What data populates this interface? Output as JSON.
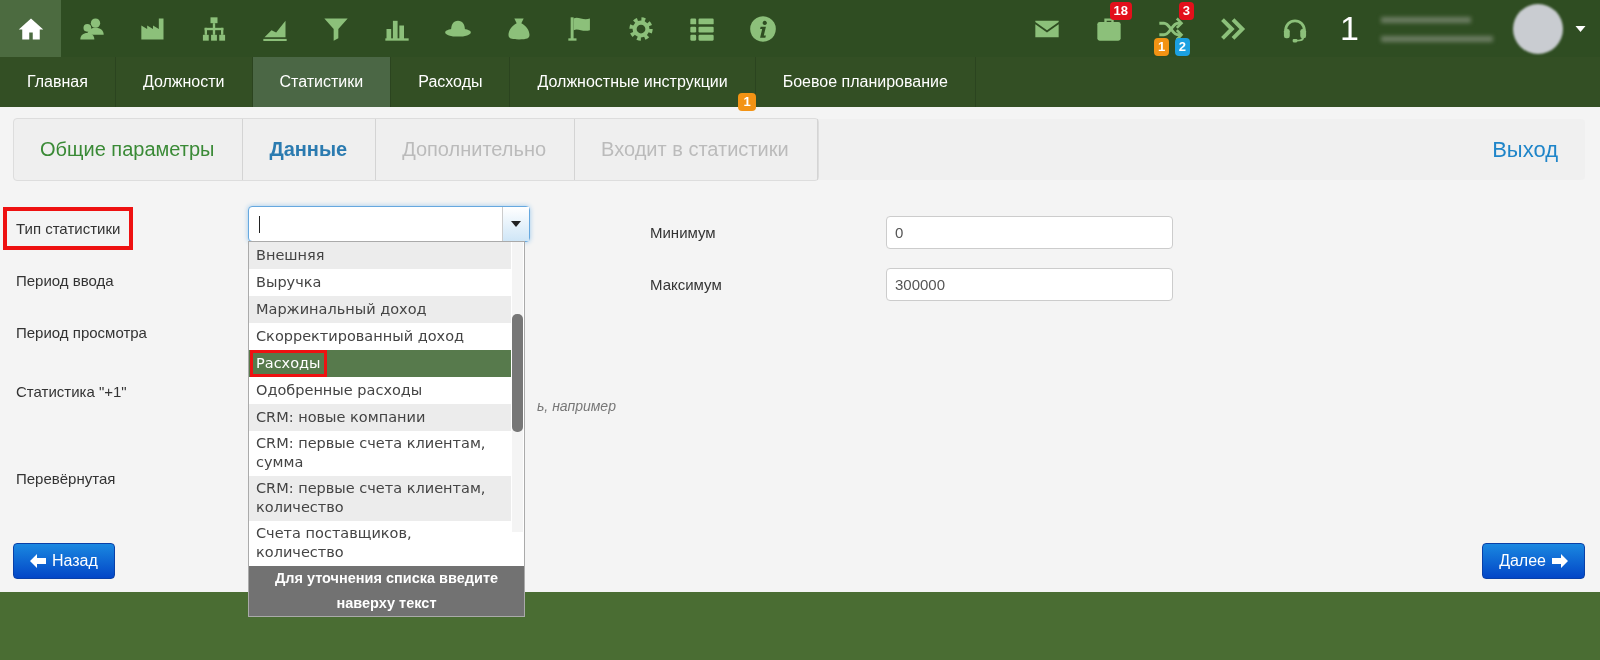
{
  "toolbar": [
    {
      "selected": true
    },
    {
      "selected": false
    },
    {
      "selected": false
    },
    {
      "selected": false
    },
    {
      "selected": false
    },
    {
      "selected": false
    },
    {
      "selected": false
    },
    {
      "selected": false
    },
    {
      "selected": false
    },
    {
      "selected": false
    },
    {
      "selected": false
    },
    {
      "selected": false
    },
    {
      "selected": false
    }
  ],
  "notifications": [
    {
      "kind": "mail"
    },
    {
      "kind": "briefcase",
      "badge": {
        "text": "18",
        "color": "#e3101b"
      }
    },
    {
      "kind": "shuffle",
      "badge": {
        "text": "3",
        "color": "#e3101b"
      },
      "sub_badges": [
        {
          "text": "1",
          "color": "#f39314"
        },
        {
          "text": "2",
          "color": "#1ba1e2"
        }
      ]
    },
    {
      "kind": "chevrons"
    },
    {
      "kind": "headset"
    }
  ],
  "counter": "1",
  "nav_tabs": [
    {
      "label": "Главная",
      "selected": false
    },
    {
      "label": "Должности",
      "selected": false
    },
    {
      "label": "Статистики",
      "selected": true
    },
    {
      "label": "Расходы",
      "selected": false
    },
    {
      "label": "Должностные инструкции",
      "selected": false,
      "badge": "1"
    },
    {
      "label": "Боевое планирование",
      "selected": false
    }
  ],
  "wizard": {
    "steps": [
      {
        "label": "Общие параметры",
        "completed": true,
        "selected": false
      },
      {
        "label": "Данные",
        "completed": false,
        "selected": true
      },
      {
        "label": "Дополнительно",
        "completed": false,
        "selected": false
      },
      {
        "label": "Входит в статистики",
        "completed": false,
        "selected": false
      }
    ],
    "exit_link": "Выход"
  },
  "form_labels": [
    {
      "label": "Тип статистики",
      "highlighted": true
    },
    {
      "label": "Период ввода",
      "highlighted": false
    },
    {
      "label": "Период просмотра",
      "highlighted": false
    },
    {
      "label": "Статистика \"+1\"",
      "highlighted": false
    },
    {
      "label": "Перевёрнутая",
      "highlighted": false
    }
  ],
  "hint_fragment": "ь, например",
  "type_select": {
    "options": [
      {
        "label": "Внешняя",
        "selected": false,
        "highlighted": false
      },
      {
        "label": "Выручка",
        "selected": false,
        "highlighted": false
      },
      {
        "label": "Маржинальный доход",
        "selected": false,
        "highlighted": false
      },
      {
        "label": "Скорректированный доход",
        "selected": false,
        "highlighted": false
      },
      {
        "label": "Расходы",
        "selected": true,
        "highlighted": true
      },
      {
        "label": "Одобренные расходы",
        "selected": false,
        "highlighted": false
      },
      {
        "label": "CRM: новые компании",
        "selected": false,
        "highlighted": false
      },
      {
        "label": "CRM: первые счета клиентам, сумма",
        "selected": false,
        "highlighted": false
      },
      {
        "label": "CRM: первые счета клиентам, количество",
        "selected": false,
        "highlighted": false
      },
      {
        "label": "Счета поставщиков, количество",
        "selected": false,
        "highlighted": false
      }
    ],
    "footer": "Для уточнения списка введите наверху текст"
  },
  "range_fields": [
    {
      "label": "Минимум",
      "value": "0"
    },
    {
      "label": "Максимум",
      "value": "300000"
    }
  ],
  "back_button": "Назад",
  "next_button": "Далее"
}
